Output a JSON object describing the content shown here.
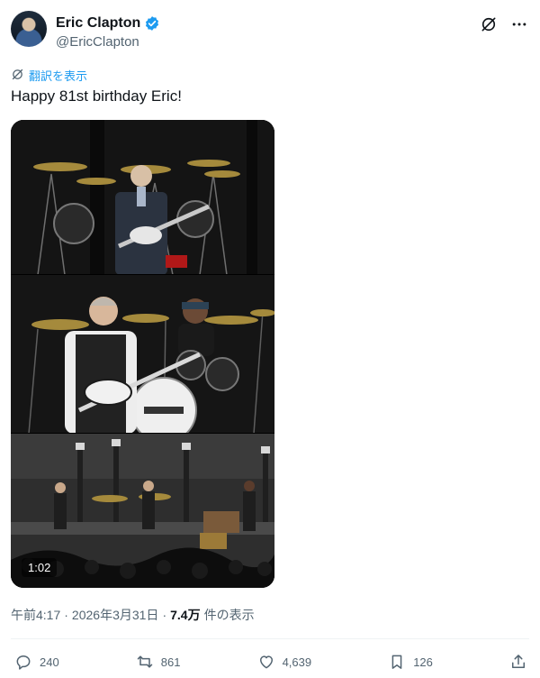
{
  "author": {
    "display_name": "Eric Clapton",
    "handle": "@EricClapton",
    "verified": true
  },
  "header_icons": [
    "grok-icon",
    "more-icon"
  ],
  "translate": {
    "label": "翻訳を表示"
  },
  "tweet": {
    "text": "Happy 81st birthday Eric!"
  },
  "media": {
    "type": "video",
    "duration": "1:02",
    "panels": 3
  },
  "meta": {
    "time": "午前4:17",
    "separator": "·",
    "date": "2026年3月31日",
    "views_value": "7.4万",
    "views_label": "件の表示"
  },
  "actions": {
    "replies": "240",
    "reposts": "861",
    "likes": "4,639",
    "bookmarks": "126"
  },
  "colors": {
    "accent": "#1d9bf0",
    "text": "#0f1419",
    "muted": "#536471"
  }
}
